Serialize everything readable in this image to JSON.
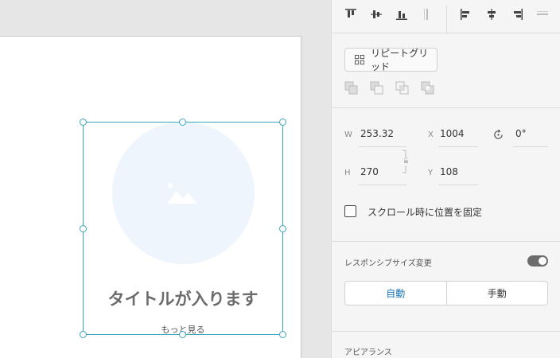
{
  "canvas": {
    "card": {
      "title": "タイトルが入ります",
      "more_link": "もっと見る"
    }
  },
  "panel": {
    "repeat_grid": {
      "label": "リピートグリッド"
    },
    "transform": {
      "w_label": "W",
      "w_value": "253.32",
      "h_label": "H",
      "h_value": "270",
      "x_label": "X",
      "x_value": "1004",
      "y_label": "Y",
      "y_value": "108",
      "rotation_value": "0°"
    },
    "fix_position": {
      "label": "スクロール時に位置を固定",
      "checked": false
    },
    "responsive": {
      "label": "レスポンシブサイズ変更",
      "enabled": true,
      "modes": [
        "自動",
        "手動"
      ],
      "active_mode": "自動"
    },
    "appearance": {
      "label": "アピアランス"
    }
  },
  "colors": {
    "selection": "#3aa6b9",
    "placeholder": "#eef5fd",
    "active_segment": "#1473b5"
  }
}
